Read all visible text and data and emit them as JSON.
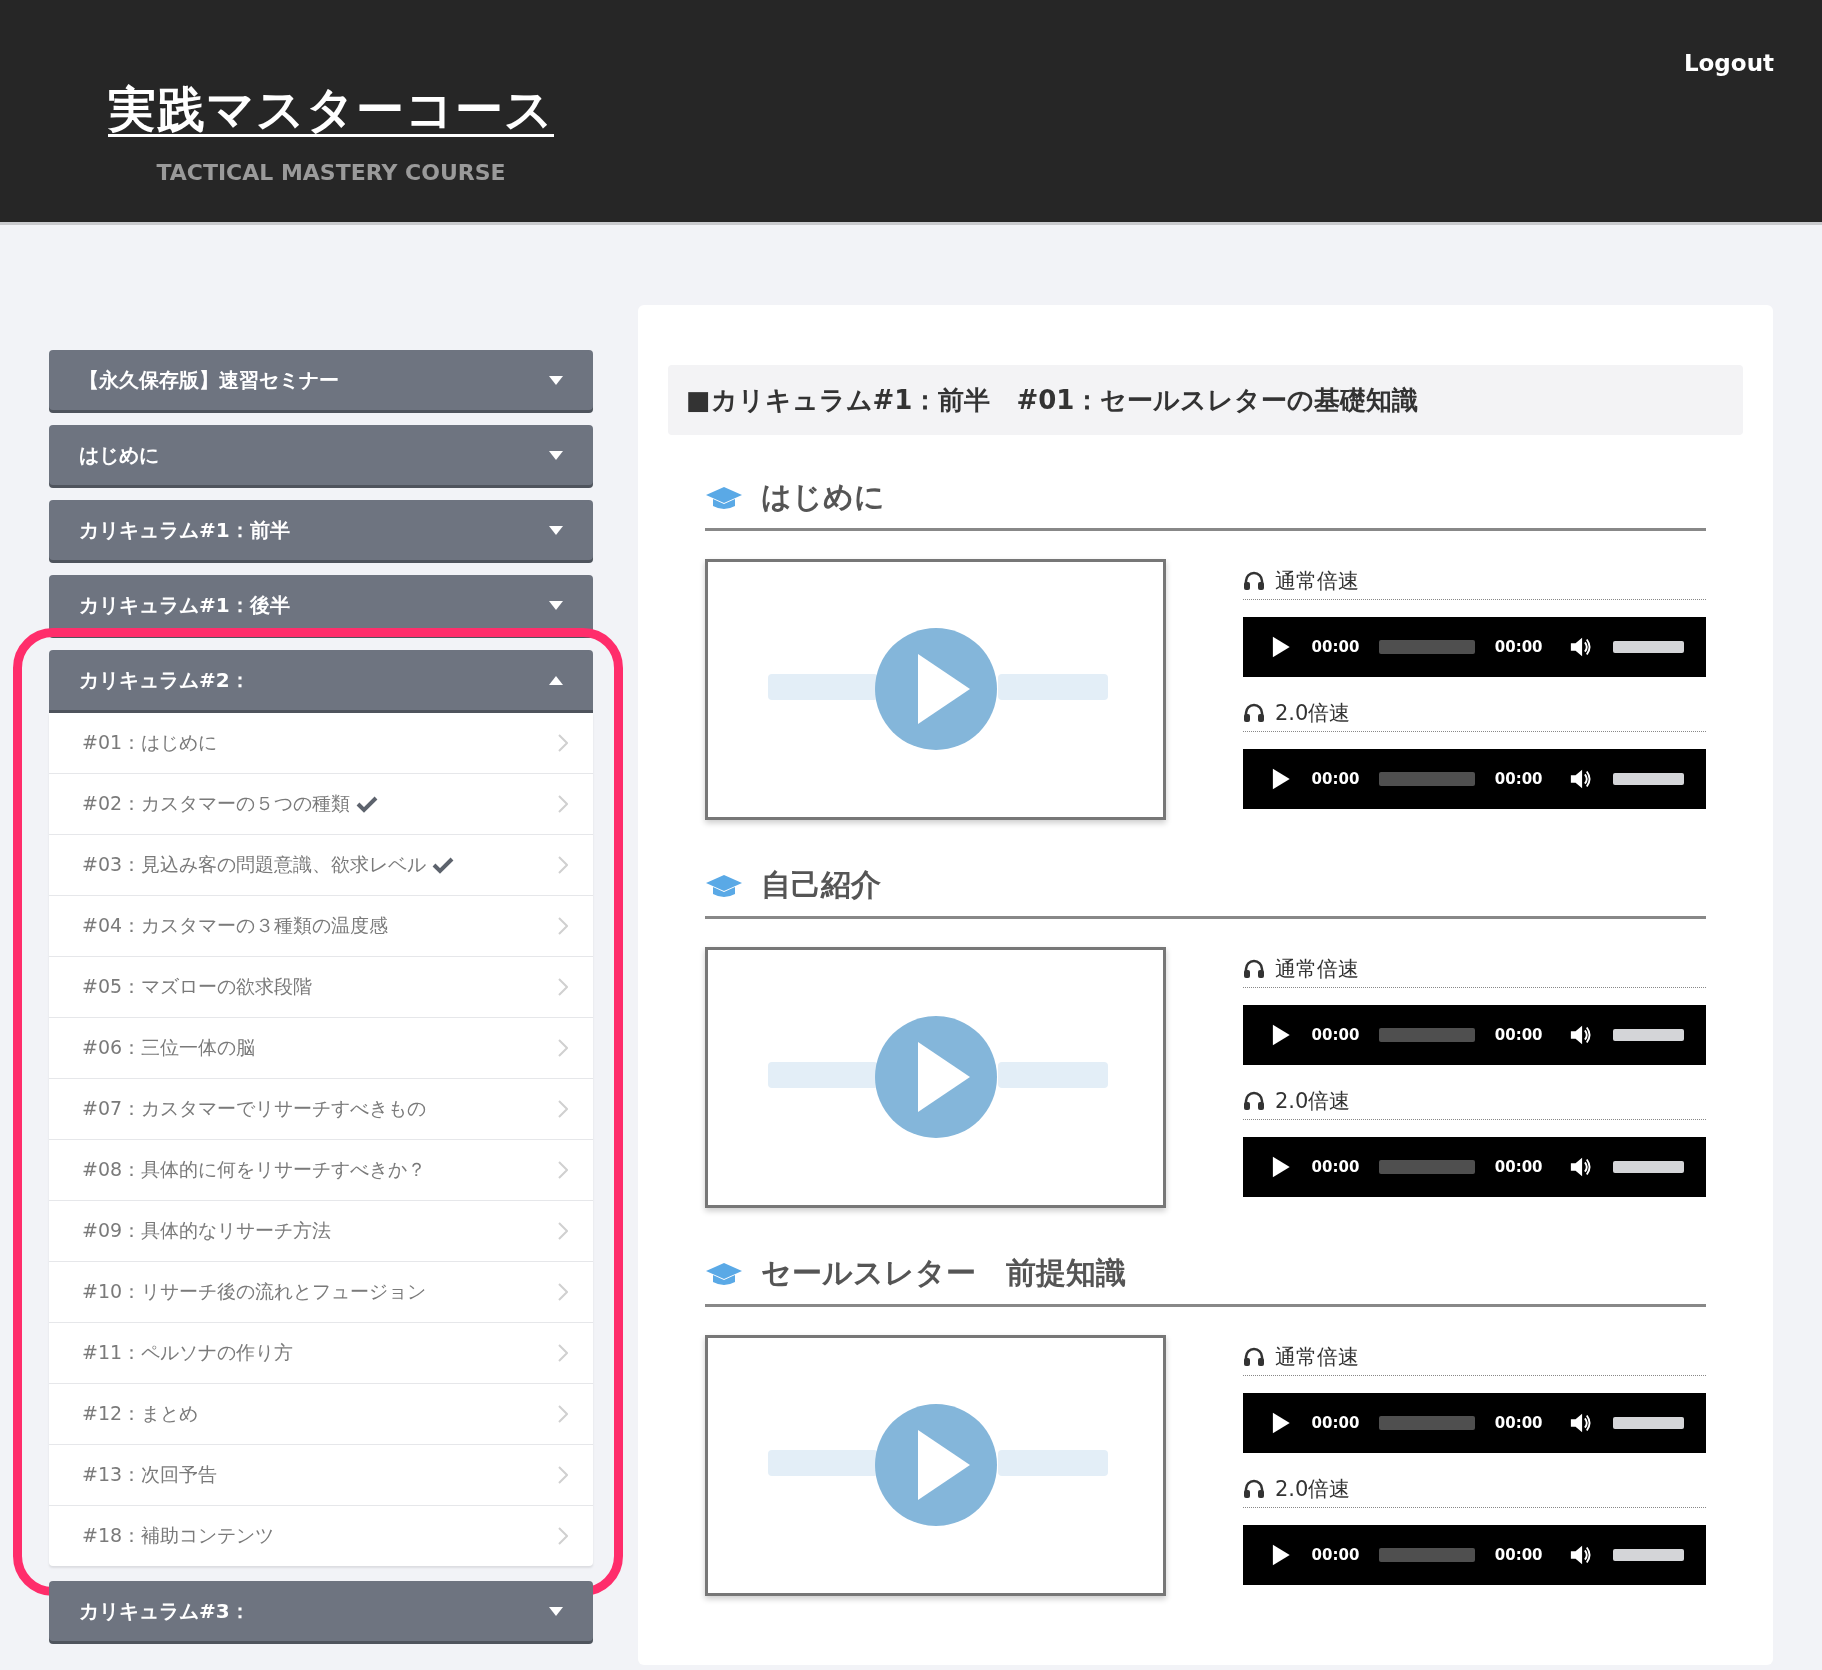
{
  "header": {
    "title": "実践マスターコース",
    "subtitle": "TACTICAL MASTERY COURSE",
    "logout": "Logout"
  },
  "sidebar": {
    "sections": [
      {
        "label": "【永久保存版】速習セミナー",
        "expanded": false,
        "highlighted": false
      },
      {
        "label": "はじめに",
        "expanded": false,
        "highlighted": false
      },
      {
        "label": "カリキュラム#1：前半",
        "expanded": false,
        "highlighted": false
      },
      {
        "label": "カリキュラム#1：後半",
        "expanded": false,
        "highlighted": false
      },
      {
        "label": "カリキュラム#2：",
        "expanded": true,
        "highlighted": true,
        "items": [
          {
            "label": "#01：はじめに",
            "completed": false
          },
          {
            "label": "#02：カスタマーの５つの種類",
            "completed": true
          },
          {
            "label": "#03：見込み客の問題意識、欲求レベル",
            "completed": true
          },
          {
            "label": "#04：カスタマーの３種類の温度感",
            "completed": false
          },
          {
            "label": "#05：マズローの欲求段階",
            "completed": false
          },
          {
            "label": "#06：三位一体の脳",
            "completed": false
          },
          {
            "label": "#07：カスタマーでリサーチすべきもの",
            "completed": false
          },
          {
            "label": "#08：具体的に何をリサーチすべきか？",
            "completed": false
          },
          {
            "label": "#09：具体的なリサーチ方法",
            "completed": false
          },
          {
            "label": "#10：リサーチ後の流れとフュージョン",
            "completed": false
          },
          {
            "label": "#11：ペルソナの作り方",
            "completed": false
          },
          {
            "label": "#12：まとめ",
            "completed": false
          },
          {
            "label": "#13：次回予告",
            "completed": false
          },
          {
            "label": "#18：補助コンテンツ",
            "completed": false
          }
        ]
      },
      {
        "label": "カリキュラム#3：",
        "expanded": false,
        "highlighted": false
      }
    ]
  },
  "main": {
    "title": "■カリキュラム#1：前半　#01：セールスレターの基礎知識",
    "lessons": [
      {
        "heading": "はじめに",
        "video": {
          "kind": "picture"
        },
        "audios": [
          {
            "label": "通常倍速",
            "current": "00:00",
            "duration": "00:00",
            "volume": {
              "level": 1
            }
          },
          {
            "label": "2.0倍速",
            "current": "00:00",
            "duration": "00:00",
            "volume": {
              "level": 1
            }
          }
        ]
      },
      {
        "heading": "自己紹介",
        "video": {
          "kind": "picture"
        },
        "audios": [
          {
            "label": "通常倍速",
            "current": "00:00",
            "duration": "00:00",
            "volume": {
              "level": 1
            }
          },
          {
            "label": "2.0倍速",
            "current": "00:00",
            "duration": "00:00",
            "volume": {
              "level": 1
            }
          }
        ]
      },
      {
        "heading": "セールスレター　前提知識",
        "video": {
          "kind": "picture"
        },
        "audios": [
          {
            "label": "通常倍速",
            "current": "00:00",
            "duration": "00:00",
            "volume": {
              "level": 1
            }
          },
          {
            "label": "2.0倍速",
            "current": "00:00",
            "duration": "00:00",
            "volume": {
              "level": 1
            }
          }
        ]
      }
    ]
  }
}
